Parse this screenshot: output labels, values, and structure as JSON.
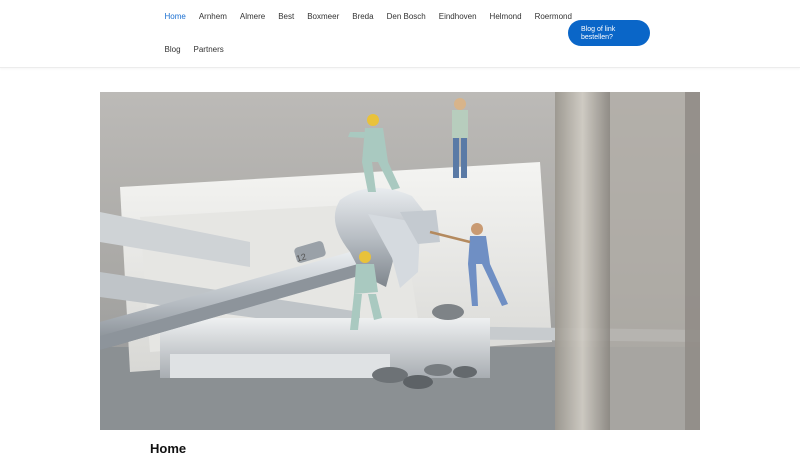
{
  "nav": {
    "row1": [
      "Home",
      "Arnhem",
      "Almere",
      "Best",
      "Boxmeer",
      "Breda",
      "Den Bosch",
      "Eindhoven",
      "Helmond",
      "Roermond"
    ],
    "row2": [
      "Blog",
      "Partners"
    ],
    "active": "Home"
  },
  "cta": {
    "line1": "Blog of link",
    "line2": "bestellen?"
  },
  "hero": {
    "image": "wrench-with-miniature-workers",
    "alt": ""
  },
  "page": {
    "title": "Home"
  },
  "colors": {
    "accent": "#1a6fd1",
    "cta_bg": "#0a66c8"
  }
}
